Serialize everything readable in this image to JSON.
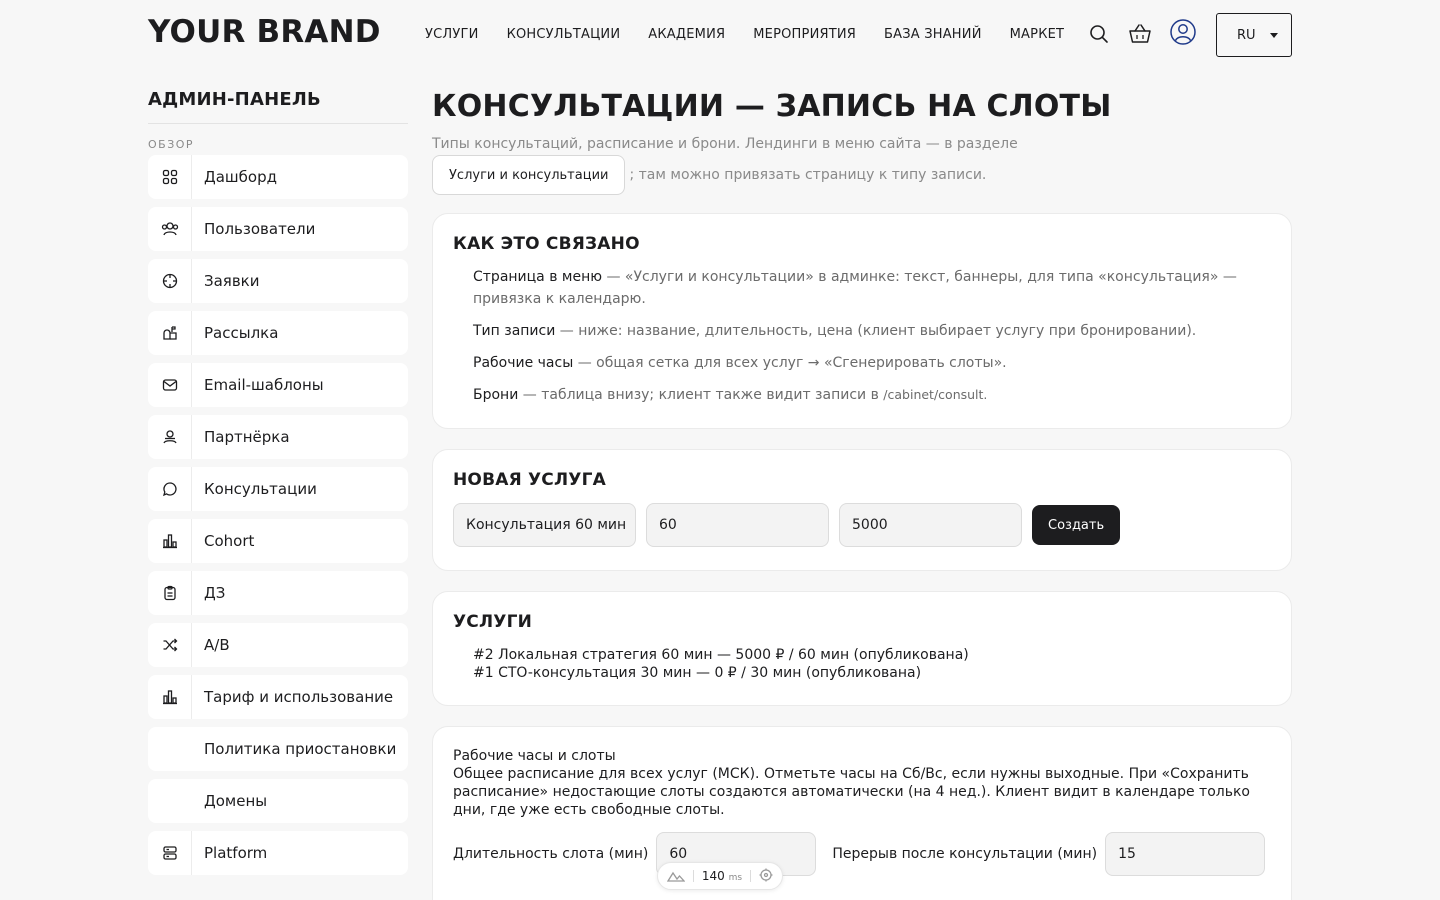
{
  "header": {
    "brand": "YOUR BRAND",
    "nav": [
      "УСЛУГИ",
      "КОНСУЛЬТАЦИИ",
      "АКАДЕМИЯ",
      "МЕРОПРИЯТИЯ",
      "БАЗА ЗНАНИЙ",
      "МАРКЕТ"
    ],
    "lang": "RU"
  },
  "sidebar": {
    "title": "АДМИН-ПАНЕЛЬ",
    "section": "ОБЗОР",
    "items": [
      {
        "label": "Дашборд",
        "icon": "dashboard-icon"
      },
      {
        "label": "Пользователи",
        "icon": "users-icon"
      },
      {
        "label": "Заявки",
        "icon": "target-icon"
      },
      {
        "label": "Рассылка",
        "icon": "mailbox-icon"
      },
      {
        "label": "Email-шаблоны",
        "icon": "envelope-icon"
      },
      {
        "label": "Партнёрка",
        "icon": "partner-icon"
      },
      {
        "label": "Консультации",
        "icon": "chat-icon"
      },
      {
        "label": "Cohort",
        "icon": "bar-chart-icon"
      },
      {
        "label": "ДЗ",
        "icon": "clipboard-icon"
      },
      {
        "label": "A/B",
        "icon": "shuffle-icon"
      },
      {
        "label": "Тариф и использование",
        "icon": "bar-chart-icon"
      },
      {
        "label": "Политика приостановки",
        "icon": ""
      },
      {
        "label": "Домены",
        "icon": ""
      },
      {
        "label": "Platform",
        "icon": "server-icon"
      }
    ]
  },
  "main": {
    "title": "КОНСУЛЬТАЦИИ — ЗАПИСЬ НА СЛОТЫ",
    "subtitle_1": "Типы консультаций, расписание и брони. Лендинги в меню сайта — в разделе",
    "subtitle_link": "Услуги и консультации",
    "subtitle_2": "; там можно привязать страницу к типу записи.",
    "how": {
      "title": "КАК ЭТО СВЯЗАНО",
      "items": [
        {
          "term": "Страница в меню",
          "text": " — «Услуги и консультации» в админке: текст, баннеры, для типа «консультация» — привязка к календарю."
        },
        {
          "term": "Тип записи",
          "text": " — ниже: название, длительность, цена (клиент выбирает услугу при бронировании)."
        },
        {
          "term": "Рабочие часы",
          "text": " — общая сетка для всех услуг → «Сгенерировать слоты»."
        },
        {
          "term": "Брони",
          "text": " — таблица внизу; клиент также видит записи в ",
          "code": "/cabinet/consult."
        }
      ]
    },
    "new_service": {
      "title": "НОВАЯ УСЛУГА",
      "name_value": "Консультация 60 мин",
      "duration_value": "60",
      "price_value": "5000",
      "create_label": "Создать"
    },
    "services": {
      "title": "УСЛУГИ",
      "items": [
        "#2 Локальная стратегия 60 мин — 5000 ₽ / 60 мин (опубликована)",
        "#1 CTO-консультация 30 мин — 0 ₽ / 30 мин (опубликована)"
      ]
    },
    "hours": {
      "title": "Рабочие часы и слоты",
      "desc": "Общее расписание для всех услуг (МСК). Отметьте часы на Сб/Вс, если нужны выходные. При «Сохранить расписание» недостающие слоты создаются автоматически (на 4 нед.). Клиент видит в календаре только дни, где уже есть свободные слоты.",
      "slot_label": "Длительность слота (мин)",
      "slot_value": "60",
      "break_label": "Перерыв после консультации (мин)",
      "break_value": "15"
    }
  },
  "perf": {
    "value": "140",
    "unit": "ms"
  }
}
